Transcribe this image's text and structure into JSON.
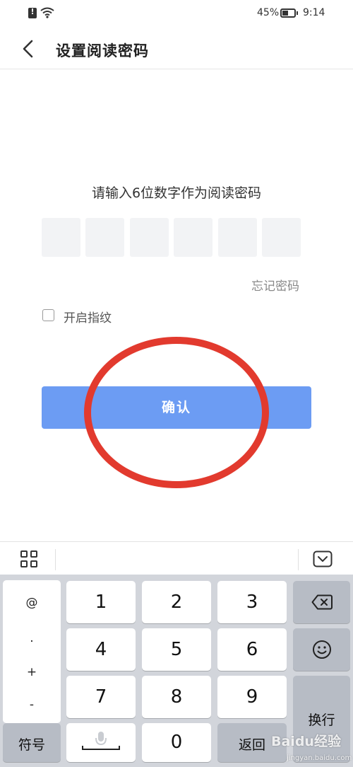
{
  "status_bar": {
    "battery": "45%",
    "time": "9:14",
    "icons": [
      "alert-icon",
      "wifi-icon",
      "battery-icon"
    ]
  },
  "header": {
    "title": "设置阅读密码",
    "back_icon": "chevron-left-icon"
  },
  "main": {
    "prompt": "请输入6位数字作为阅读密码",
    "pin_length": 6,
    "forgot_password": "忘记密码",
    "fingerprint_label": "开启指纹",
    "fingerprint_checked": false,
    "confirm_label": "确认",
    "annotation_color": "#e23a2e",
    "button_color": "#6c9cf3"
  },
  "keyboard": {
    "toolbar": {
      "left_icon": "grid-icon",
      "right_icon": "hide-keyboard-icon"
    },
    "symbols": [
      "@",
      ".",
      "+",
      "-"
    ],
    "keys": {
      "k1": "1",
      "k2": "2",
      "k3": "3",
      "k4": "4",
      "k5": "5",
      "k6": "6",
      "k7": "7",
      "k8": "8",
      "k9": "9",
      "k0": "0"
    },
    "symbol_key": "符号",
    "enter_key": "换行",
    "return_key": "返回",
    "backspace_icon": "backspace-icon",
    "emoji_icon": "emoji-icon",
    "mic_icon": "microphone-icon"
  },
  "watermark": {
    "text": "Baidu经验",
    "sub": "jingyan.baidu.com"
  }
}
